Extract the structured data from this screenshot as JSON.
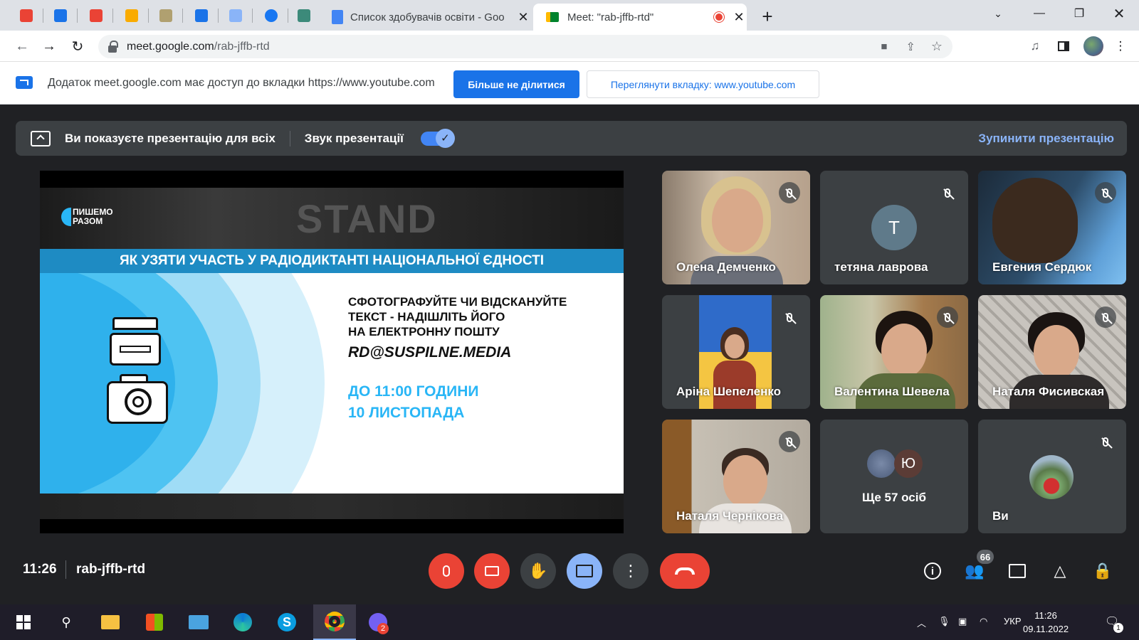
{
  "browser": {
    "pinned_tabs": [
      {
        "icon": "gmail-icon",
        "color": "#ea4335"
      },
      {
        "icon": "messenger-icon",
        "color": "#1a73e8"
      },
      {
        "icon": "gmail-icon",
        "color": "#ea4335"
      },
      {
        "icon": "sun-icon",
        "color": "#f9ab00"
      },
      {
        "icon": "certificate-icon",
        "color": "#b0a070"
      },
      {
        "icon": "monitor-icon",
        "color": "#1a73e8"
      },
      {
        "icon": "map-icon",
        "color": "#8ab4f8"
      },
      {
        "icon": "facebook-icon",
        "color": "#1877f2"
      },
      {
        "icon": "imzo-icon",
        "color": "#3c8a7a"
      }
    ],
    "tabs": [
      {
        "title": "Список здобувачів освіти - Goo",
        "close": "✕"
      },
      {
        "title": "Meet: \"rab-jffb-rtd\"",
        "close": "✕"
      }
    ],
    "new_tab": "+",
    "address": {
      "domain": "meet.google.com",
      "path": "/rab-jffb-rtd"
    }
  },
  "infobar": {
    "text": "Додаток meet.google.com має доступ до вкладки https://www.youtube.com",
    "stop_sharing": "Більше не ділитися",
    "view_tab": "Переглянути вкладку: www.youtube.com"
  },
  "presenting": {
    "status": "Ви показуєте презентацію для всіх",
    "audio_label": "Звук презентації",
    "audio_on": true,
    "stop": "Зупинити презентацію"
  },
  "slide": {
    "logo_line1": "ПИШЕМО",
    "logo_line2": "РАЗОМ",
    "background_text": "STAND",
    "heading": "ЯК УЗЯТИ УЧАСТЬ У РАДІОДИКТАНТІ НАЦІОНАЛЬНОЇ ЄДНОСТІ",
    "instruction_1": "СФОТОГРАФУЙТЕ ЧИ ВІДСКАНУЙТЕ",
    "instruction_2": "ТЕКСТ - НАДІШЛІТЬ ЙОГО",
    "instruction_3": "НА ЕЛЕКТРОННУ ПОШТУ",
    "email": "RD@SUSPILNE.MEDIA",
    "deadline_1": "ДО 11:00 ГОДИНИ",
    "deadline_2": "10 ЛИСТОПАДА",
    "accent": "#29b6f6"
  },
  "participants": [
    {
      "name": "Олена Демченко",
      "muted": true
    },
    {
      "name": "тетяна лаврова",
      "muted": true,
      "initial": "Т"
    },
    {
      "name": "Евгения Сердюк",
      "muted": true
    },
    {
      "name": "Аріна Шепеленко",
      "muted": true
    },
    {
      "name": "Валентина Шевела",
      "muted": true
    },
    {
      "name": "Наталя Фисивская",
      "muted": true
    },
    {
      "name": "Наталя Чернікова",
      "muted": true
    },
    {
      "name": "Ще 57 осіб",
      "initial": "Ю"
    },
    {
      "name": "Ви",
      "muted": true
    }
  ],
  "controls": {
    "time": "11:26",
    "meeting_code": "rab-jffb-rtd",
    "participants_count": "66"
  },
  "taskbar": {
    "language": "УКР",
    "time": "11:26",
    "date": "09.11.2022",
    "viber_badge": "2",
    "notifications": "1"
  }
}
